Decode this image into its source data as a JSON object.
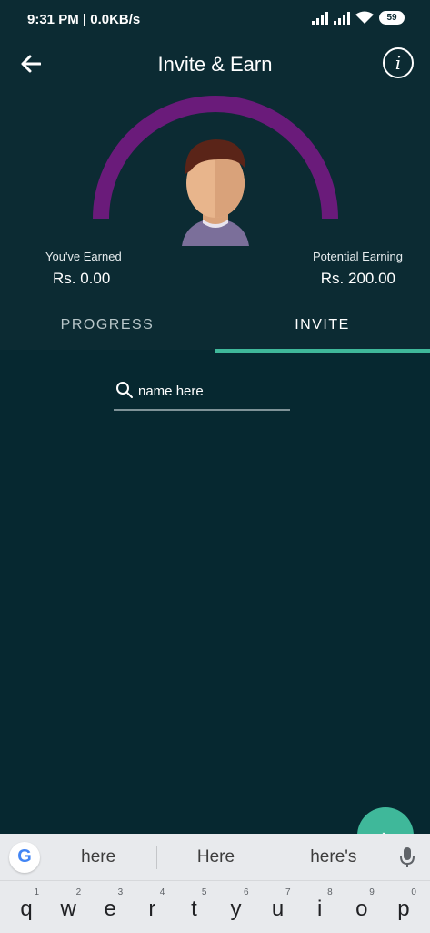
{
  "status_bar": {
    "time_text": "9:31 PM | 0.0KB/s",
    "battery": "59"
  },
  "app_bar": {
    "title": "Invite & Earn",
    "back_icon": "arrow-left-icon",
    "info_icon": "info-icon",
    "info_glyph": "i"
  },
  "earnings": {
    "earned_label": "You've Earned",
    "earned_value": "Rs. 0.00",
    "potential_label": "Potential Earning",
    "potential_value": "Rs. 200.00",
    "progress_fraction": 0
  },
  "tabs": [
    {
      "label": "PROGRESS",
      "selected": false
    },
    {
      "label": "INVITE",
      "selected": true
    }
  ],
  "search": {
    "value": "name here",
    "icon": "search-icon"
  },
  "fab": {
    "icon": "arrow-right-icon",
    "glyph": "›"
  },
  "keyboard": {
    "google_glyph": "G",
    "suggestions": [
      "here",
      "Here",
      "here's"
    ],
    "keys": [
      {
        "letter": "q",
        "hint": "1"
      },
      {
        "letter": "w",
        "hint": "2"
      },
      {
        "letter": "e",
        "hint": "3"
      },
      {
        "letter": "r",
        "hint": "4"
      },
      {
        "letter": "t",
        "hint": "5"
      },
      {
        "letter": "y",
        "hint": "6"
      },
      {
        "letter": "u",
        "hint": "7"
      },
      {
        "letter": "i",
        "hint": "8"
      },
      {
        "letter": "o",
        "hint": "9"
      },
      {
        "letter": "p",
        "hint": "0"
      }
    ]
  },
  "colors": {
    "header_bg": "#0c2b33",
    "body_bg": "#062830",
    "accent": "#3fb89a",
    "gauge_arc": "#6a1b7a"
  }
}
